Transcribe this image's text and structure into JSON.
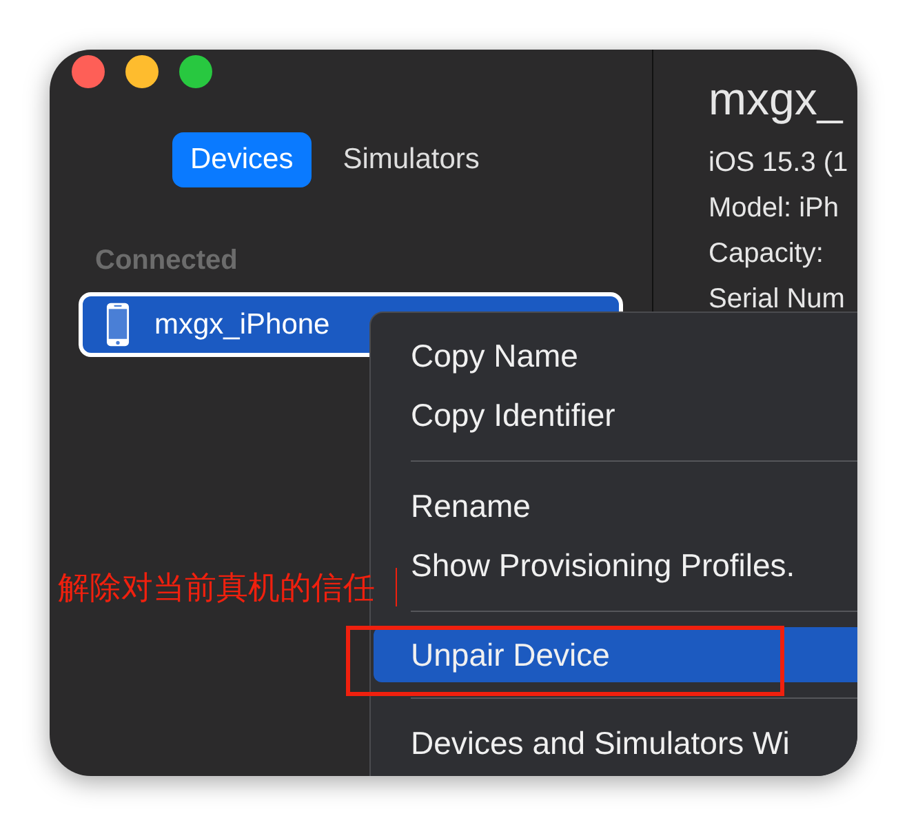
{
  "window": {
    "controls": [
      {
        "kind": "close"
      },
      {
        "kind": "minimize"
      },
      {
        "kind": "zoom"
      }
    ]
  },
  "tabs": [
    {
      "label": "Devices",
      "selected": true
    },
    {
      "label": "Simulators",
      "selected": false
    }
  ],
  "sidebar": {
    "section": "Connected",
    "devices": [
      {
        "name": "mxgx_iPhone",
        "selected": true
      }
    ]
  },
  "detail": {
    "title": "mxgx_",
    "lines": [
      "iOS 15.3 (1",
      "Model: iPh",
      "Capacity:",
      "Serial Num"
    ]
  },
  "context_menu": {
    "groups": [
      [
        {
          "label": "Copy Name",
          "selected": false
        },
        {
          "label": "Copy Identifier",
          "selected": false
        }
      ],
      [
        {
          "label": "Rename",
          "selected": false
        },
        {
          "label": "Show Provisioning Profiles.",
          "selected": false
        }
      ],
      [
        {
          "label": "Unpair Device",
          "selected": true
        }
      ],
      [
        {
          "label": "Devices and Simulators Wi",
          "selected": false
        }
      ]
    ]
  },
  "annotation": {
    "label": "解除对当前真机的信任"
  }
}
